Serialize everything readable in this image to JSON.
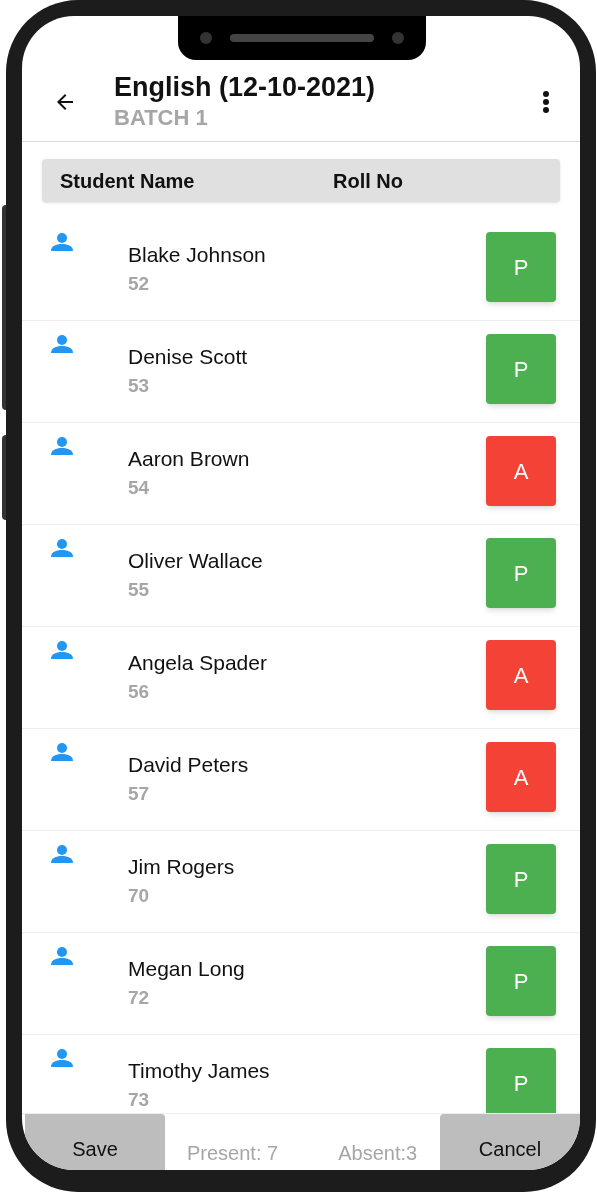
{
  "header": {
    "title": "English (12-10-2021)",
    "subtitle": "BATCH 1"
  },
  "columns": [
    "Student Name",
    "Roll No"
  ],
  "students": [
    {
      "name": "Blake Johnson",
      "roll": "52",
      "mark": "P",
      "present": true
    },
    {
      "name": "Denise Scott",
      "roll": "53",
      "mark": "P",
      "present": true
    },
    {
      "name": "Aaron Brown",
      "roll": "54",
      "mark": "A",
      "present": false
    },
    {
      "name": "Oliver Wallace",
      "roll": "55",
      "mark": "P",
      "present": true
    },
    {
      "name": "Angela Spader",
      "roll": "56",
      "mark": "A",
      "present": false
    },
    {
      "name": "David Peters",
      "roll": "57",
      "mark": "A",
      "present": false
    },
    {
      "name": "Jim Rogers",
      "roll": "70",
      "mark": "P",
      "present": true
    },
    {
      "name": "Megan Long",
      "roll": "72",
      "mark": "P",
      "present": true
    },
    {
      "name": "Timothy James",
      "roll": "73",
      "mark": "P",
      "present": true
    }
  ],
  "footer": {
    "save": "Save",
    "present": "Present: 7",
    "absent": "Absent:3",
    "cancel": "Cancel"
  }
}
